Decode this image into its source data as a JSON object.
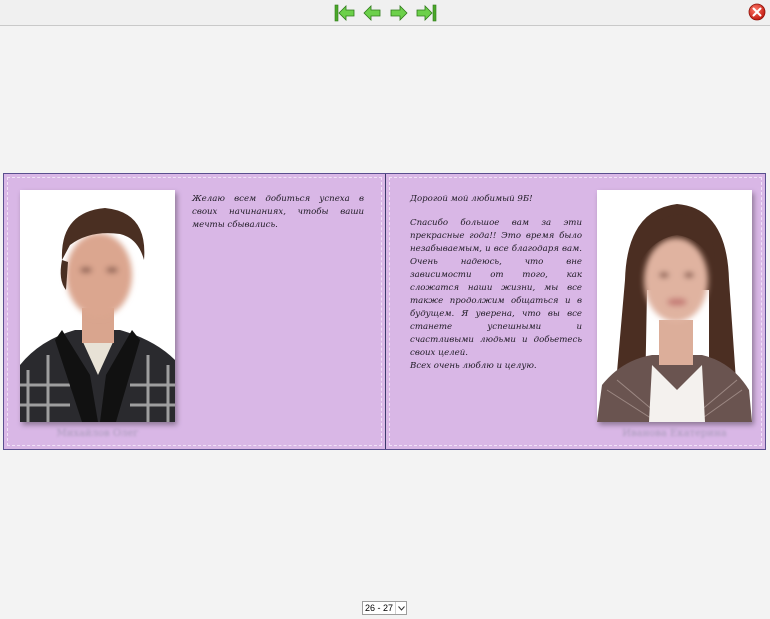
{
  "toolbar": {
    "buttons": [
      {
        "name": "first-page-icon"
      },
      {
        "name": "previous-page-icon"
      },
      {
        "name": "next-page-icon"
      },
      {
        "name": "last-page-icon"
      }
    ],
    "close_icon": "close-icon",
    "accent_color": "#5cc53a"
  },
  "spread": {
    "background_color": "#d8b6e6",
    "left_page": {
      "caption": "Михайлов Олег",
      "message": [
        "Желаю всем добиться успеха в своих начинаниях, чтобы ваши мечты сбывались."
      ]
    },
    "right_page": {
      "caption": "Иванова Екатерина",
      "greeting": "Дорогой мой любимый 9Б!",
      "message": [
        "Спасибо большое вам за эти прекрасные года!! Это время было незабываемым, и все благодаря вам. Очень надеюсь, что вне зависимости от того, как сложатся наши жизни, мы все также продолжим общаться и в будущем. Я уверена, что вы все станете успешными и счастливыми людьми и добьетесь своих целей.",
        "Всех очень люблю и целую."
      ]
    }
  },
  "page_selector": {
    "value": "26 - 27"
  }
}
